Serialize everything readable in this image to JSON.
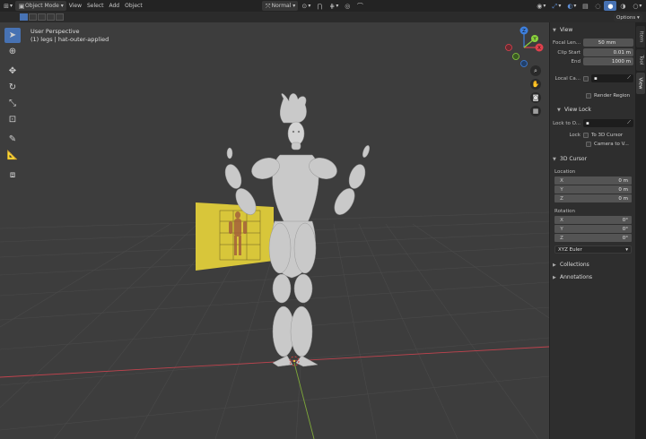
{
  "header": {
    "mode_label": "Object Mode",
    "menu": [
      "View",
      "Select",
      "Add",
      "Object"
    ],
    "orientation_label": "Normal",
    "options_label": "Options"
  },
  "viewport": {
    "perspective_label": "User Perspective",
    "object_label": "(1) legs | hat-outer-applied"
  },
  "gizmo": {
    "z": "Z",
    "y": "Y",
    "x": "X"
  },
  "sidebar": {
    "tabs": [
      "Item",
      "Tool",
      "View"
    ],
    "view": {
      "title": "View",
      "focal_label": "Focal Len...",
      "focal_value": "50 mm",
      "clip_start_label": "Clip Start",
      "clip_start_value": "0.01 m",
      "end_label": "End",
      "end_value": "1000 m",
      "local_camera_label": "Local Ca...",
      "render_region_label": "Render Region"
    },
    "view_lock": {
      "title": "View Lock",
      "lock_to_label": "Lock to O...",
      "lock_label": "Lock",
      "to_3d_cursor_label": "To 3D Cursor",
      "camera_to_view_label": "Camera to V..."
    },
    "cursor": {
      "title": "3D Cursor",
      "location_label": "Location",
      "loc": [
        {
          "axis": "X",
          "value": "0 m"
        },
        {
          "axis": "Y",
          "value": "0 m"
        },
        {
          "axis": "Z",
          "value": "0 m"
        }
      ],
      "rotation_label": "Rotation",
      "rot": [
        {
          "axis": "X",
          "value": "0°"
        },
        {
          "axis": "Y",
          "value": "0°"
        },
        {
          "axis": "Z",
          "value": "0°"
        }
      ],
      "rotation_mode": "XYZ Euler"
    },
    "collections_title": "Collections",
    "annotations_title": "Annotations"
  },
  "colors": {
    "accent": "#4772b3",
    "x_axis": "#e0414d",
    "y_axis": "#8ad23d",
    "z_axis": "#3d80e0",
    "reference_image": "#d8c63a"
  }
}
